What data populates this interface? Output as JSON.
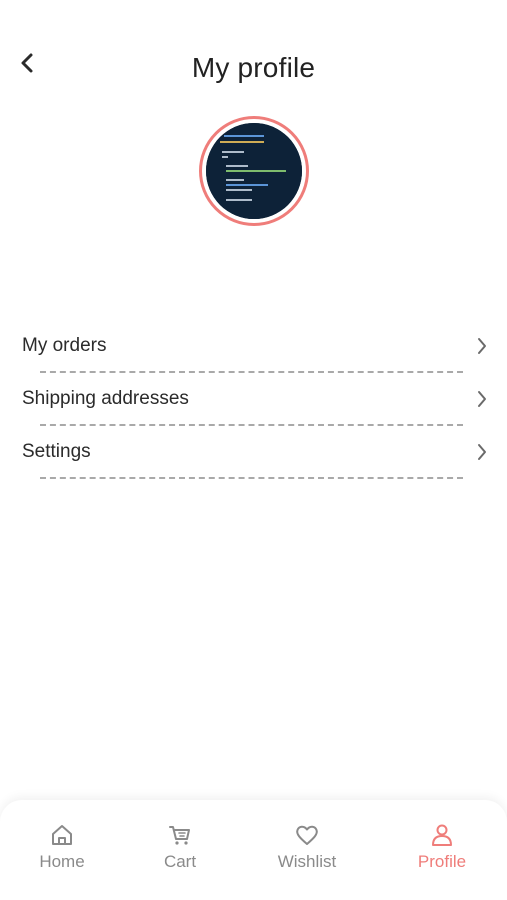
{
  "header": {
    "title": "My profile",
    "back_icon": "chevron-left-icon"
  },
  "profile": {
    "avatar_icon": "code-editor-avatar",
    "avatar_ring_color": "#ef7d7a"
  },
  "menu": {
    "items": [
      {
        "label": "My orders",
        "icon": "chevron-right-icon"
      },
      {
        "label": "Shipping addresses",
        "icon": "chevron-right-icon"
      },
      {
        "label": "Settings",
        "icon": "chevron-right-icon"
      }
    ]
  },
  "tabbar": {
    "active_color": "#ef7d7a",
    "inactive_color": "#8a8a8a",
    "tabs": [
      {
        "label": "Home",
        "icon": "home-icon"
      },
      {
        "label": "Cart",
        "icon": "cart-icon"
      },
      {
        "label": "Wishlist",
        "icon": "heart-icon"
      },
      {
        "label": "Profile",
        "icon": "user-icon",
        "active": true
      }
    ]
  }
}
